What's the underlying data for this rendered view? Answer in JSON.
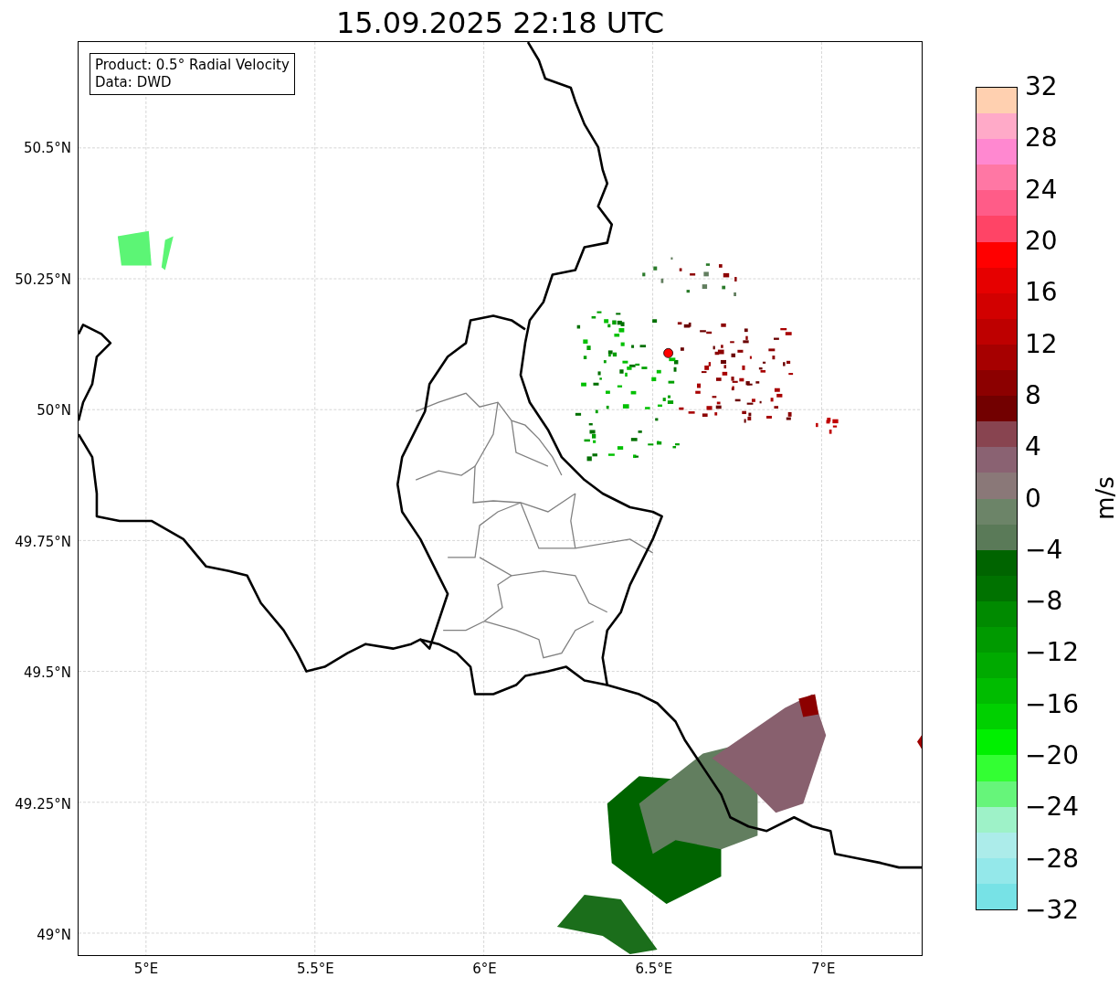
{
  "title": "15.09.2025 22:18 UTC",
  "map": {
    "info_box": [
      "Product: 0.5° Radial Velocity",
      "Data: DWD"
    ],
    "lat_ticks": [
      "50.5°N",
      "50.25°N",
      "50°N",
      "49.75°N",
      "49.5°N",
      "49.25°N",
      "49°N"
    ],
    "lon_ticks": [
      "5°E",
      "5.5°E",
      "6°E",
      "6.5°E",
      "7°E"
    ]
  },
  "colorbar": {
    "label": "m/s",
    "ticks": [
      "32",
      "28",
      "24",
      "20",
      "16",
      "12",
      "8",
      "4",
      "0",
      "−4",
      "−8",
      "−12",
      "−16",
      "−20",
      "−24",
      "−28",
      "−32"
    ],
    "bins": [
      {
        "color": "#ffd0b0"
      },
      {
        "color": "#ffaac8"
      },
      {
        "color": "#ff88d0"
      },
      {
        "color": "#ff77a4"
      },
      {
        "color": "#ff5c88"
      },
      {
        "color": "#ff4466"
      },
      {
        "color": "#ff0000"
      },
      {
        "color": "#e60000"
      },
      {
        "color": "#d20000"
      },
      {
        "color": "#be0000"
      },
      {
        "color": "#a60000"
      },
      {
        "color": "#8c0000"
      },
      {
        "color": "#720000"
      },
      {
        "color": "#884450"
      },
      {
        "color": "#8a6272"
      },
      {
        "color": "#8a7878"
      },
      {
        "color": "#6c8468"
      },
      {
        "color": "#5a7a58"
      },
      {
        "color": "#006400"
      },
      {
        "color": "#007200"
      },
      {
        "color": "#008a00"
      },
      {
        "color": "#009a00"
      },
      {
        "color": "#00aa00"
      },
      {
        "color": "#00bc00"
      },
      {
        "color": "#00d000"
      },
      {
        "color": "#00f000"
      },
      {
        "color": "#33ff33"
      },
      {
        "color": "#66f57a"
      },
      {
        "color": "#9ef2c8"
      },
      {
        "color": "#acecea"
      },
      {
        "color": "#94e8ea"
      },
      {
        "color": "#77e2e6"
      }
    ]
  }
}
